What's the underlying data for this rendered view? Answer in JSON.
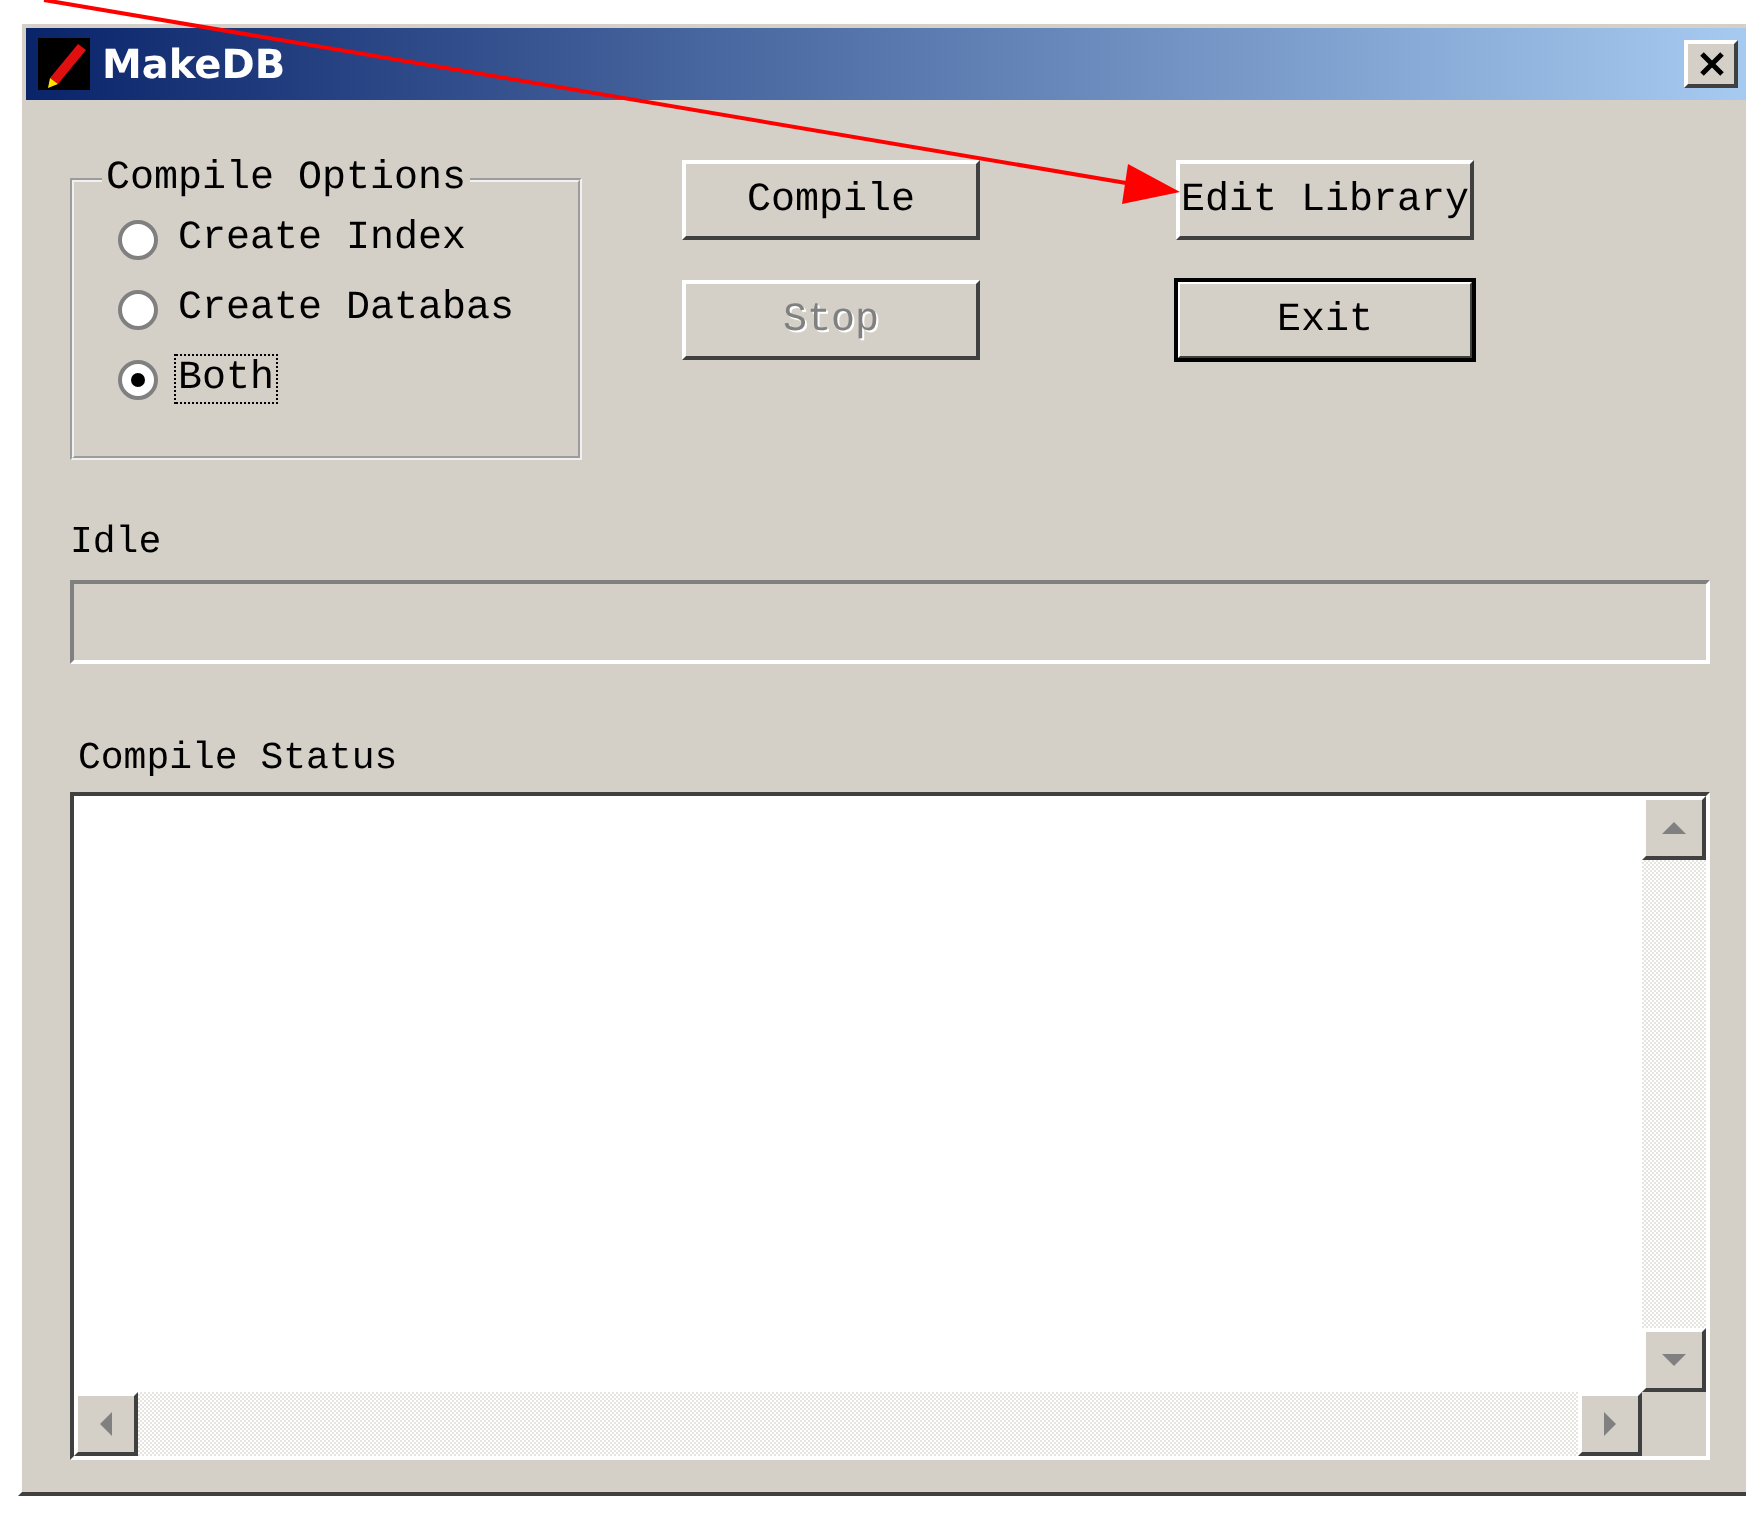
{
  "window": {
    "title": "MakeDB"
  },
  "compile_options": {
    "title": "Compile Options",
    "options": [
      {
        "label": "Create Index",
        "selected": false,
        "focused": false
      },
      {
        "label": "Create Databas",
        "selected": false,
        "focused": false
      },
      {
        "label": "Both",
        "selected": true,
        "focused": true
      }
    ]
  },
  "buttons": [
    {
      "label": "Compile",
      "disabled": false,
      "default": false
    },
    {
      "label": "Edit Library",
      "disabled": false,
      "default": false
    },
    {
      "label": "Stop",
      "disabled": true,
      "default": false
    },
    {
      "label": "Exit",
      "disabled": false,
      "default": true
    }
  ],
  "progress": {
    "label": "Idle"
  },
  "status_log": {
    "label": "Compile Status"
  }
}
